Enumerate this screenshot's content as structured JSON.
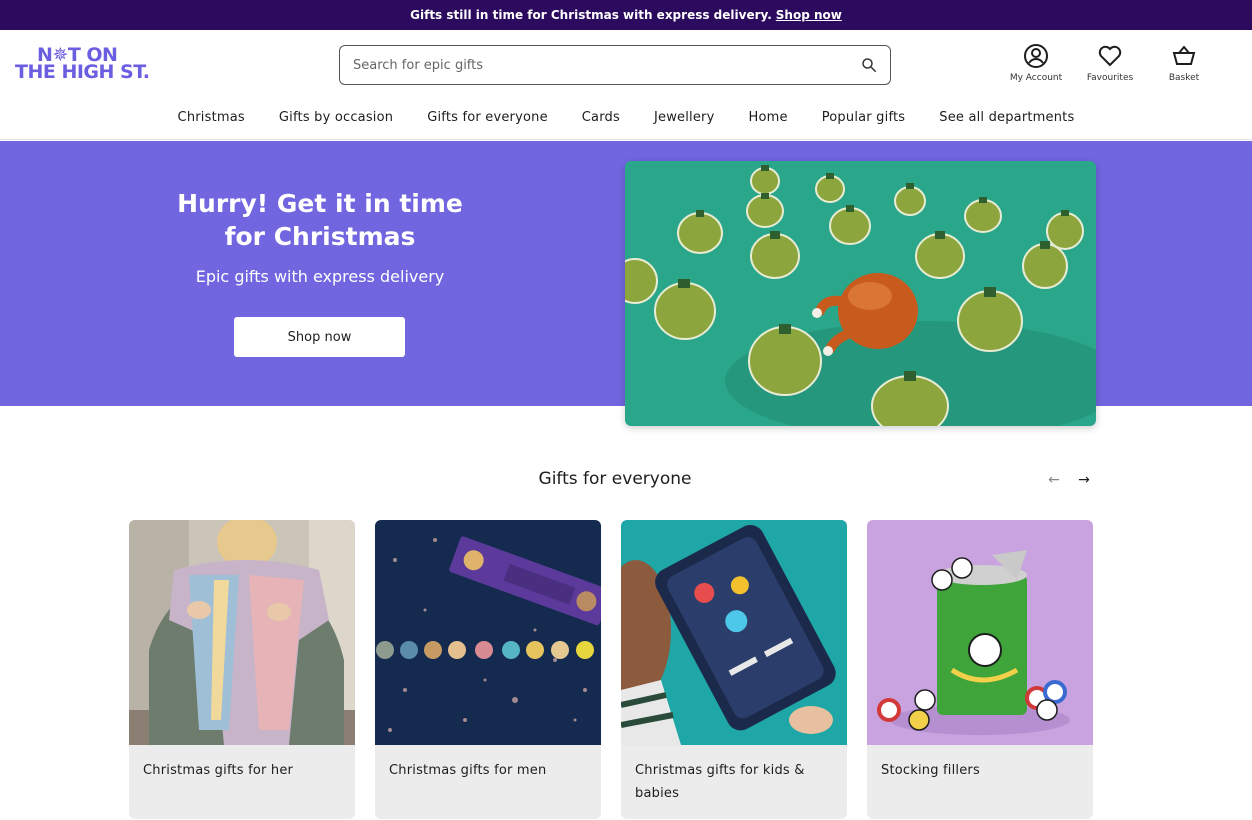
{
  "promo": {
    "text": "Gifts still in time for Christmas with express delivery.",
    "link": "Shop now"
  },
  "logo": {
    "line1": "N✵T ON",
    "line2": "THE HIGH ST."
  },
  "search": {
    "placeholder": "Search for epic gifts"
  },
  "utils": {
    "account": "My Account",
    "favourites": "Favourites",
    "basket": "Basket"
  },
  "nav": [
    "Christmas",
    "Gifts by occasion",
    "Gifts for everyone",
    "Cards",
    "Jewellery",
    "Home",
    "Popular gifts",
    "See all departments"
  ],
  "hero": {
    "title": "Hurry! Get it in time for Christmas",
    "subtitle": "Epic gifts with express delivery",
    "button": "Shop now"
  },
  "section": {
    "title": "Gifts for everyone"
  },
  "cards": [
    {
      "label": "Christmas gifts for her"
    },
    {
      "label": "Christmas gifts for men"
    },
    {
      "label": "Christmas gifts for kids & babies"
    },
    {
      "label": "Stocking fillers"
    }
  ],
  "colors": {
    "brand": "#6b5ee0",
    "hero_bg": "#7166e0",
    "promo_bg": "#2c0b5e"
  }
}
